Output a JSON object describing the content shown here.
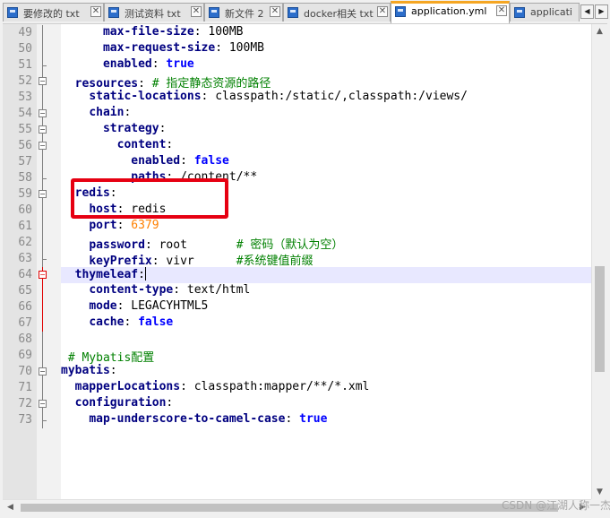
{
  "tabs": [
    {
      "label": "要修改的 txt"
    },
    {
      "label": "测试资料 txt"
    },
    {
      "label": "新文件 2"
    },
    {
      "label": "docker相关 txt"
    },
    {
      "label": "application.yml"
    },
    {
      "label": "applicati"
    }
  ],
  "active_tab": "application.yml",
  "nav": {
    "prev": "◀",
    "next": "▶"
  },
  "icons": {
    "tab_file": "file-save-icon",
    "tab_close": "close-icon",
    "fold_box": "fold-minus-icon"
  },
  "lines": [
    {
      "num": "49",
      "text": "      max-file-size: 100MB"
    },
    {
      "num": "50",
      "text": "      max-request-size: 100MB"
    },
    {
      "num": "51",
      "text": "      enabled: true"
    },
    {
      "num": "52",
      "text": "  resources: # 指定静态资源的路径"
    },
    {
      "num": "53",
      "text": "    static-locations: classpath:/static/,classpath:/views/"
    },
    {
      "num": "54",
      "text": "    chain:"
    },
    {
      "num": "55",
      "text": "      strategy:"
    },
    {
      "num": "56",
      "text": "        content:"
    },
    {
      "num": "57",
      "text": "          enabled: false"
    },
    {
      "num": "58",
      "text": "          paths: /content/**"
    },
    {
      "num": "59",
      "text": "  redis:"
    },
    {
      "num": "60",
      "text": "    host: redis"
    },
    {
      "num": "61",
      "text": "    port: 6379"
    },
    {
      "num": "62",
      "text": "    password: root       # 密码（默认为空）"
    },
    {
      "num": "63",
      "text": "    keyPrefix: vivr      #系统键值前缀"
    },
    {
      "num": "64",
      "text": "  thymeleaf:"
    },
    {
      "num": "65",
      "text": "    content-type: text/html"
    },
    {
      "num": "66",
      "text": "    mode: LEGACYHTML5"
    },
    {
      "num": "67",
      "text": "    cache: false"
    },
    {
      "num": "68",
      "text": ""
    },
    {
      "num": "69",
      "text": " # Mybatis配置"
    },
    {
      "num": "70",
      "text": "mybatis:"
    },
    {
      "num": "71",
      "text": "  mapperLocations: classpath:mapper/**/*.xml"
    },
    {
      "num": "72",
      "text": "  configuration:"
    },
    {
      "num": "73",
      "text": "    map-underscore-to-camel-case: true"
    }
  ],
  "watermark": "CSDN @江湖人称一杰",
  "colors": {
    "key": "#000080",
    "boolean": "#0000ff",
    "number": "#ff8000",
    "comment": "#008000",
    "current_line": "#e8e8ff",
    "active_tab_accent": "#f5a623",
    "annotation_box": "#e60012"
  }
}
